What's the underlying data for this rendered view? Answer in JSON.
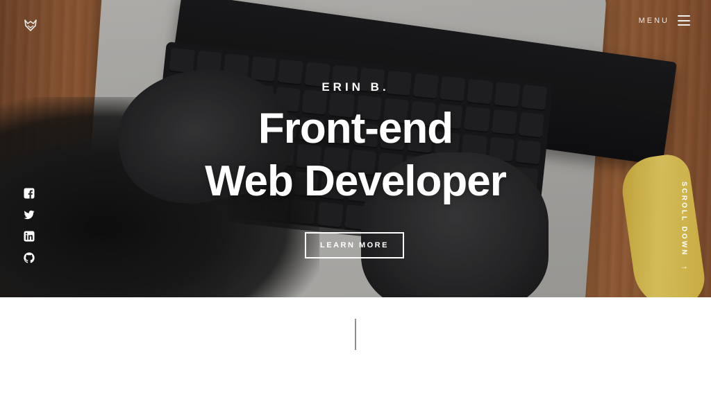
{
  "header": {
    "logo_icon": "fox-logo-icon",
    "menu_label": "MENU",
    "menu_icon": "hamburger-icon"
  },
  "hero": {
    "name": "ERIN B.",
    "title_line_1": "Front-end",
    "title_line_2": "Web Developer",
    "cta_label": "LEARN MORE",
    "scroll_label": "SCROLL DOWN",
    "scroll_arrow": "→"
  },
  "social": [
    {
      "icon": "facebook-icon"
    },
    {
      "icon": "twitter-icon"
    },
    {
      "icon": "linkedin-icon"
    },
    {
      "icon": "github-icon"
    }
  ],
  "colors": {
    "text_on_hero": "#ffffff",
    "page_background": "#ffffff",
    "divider": "#8e8e8e"
  }
}
